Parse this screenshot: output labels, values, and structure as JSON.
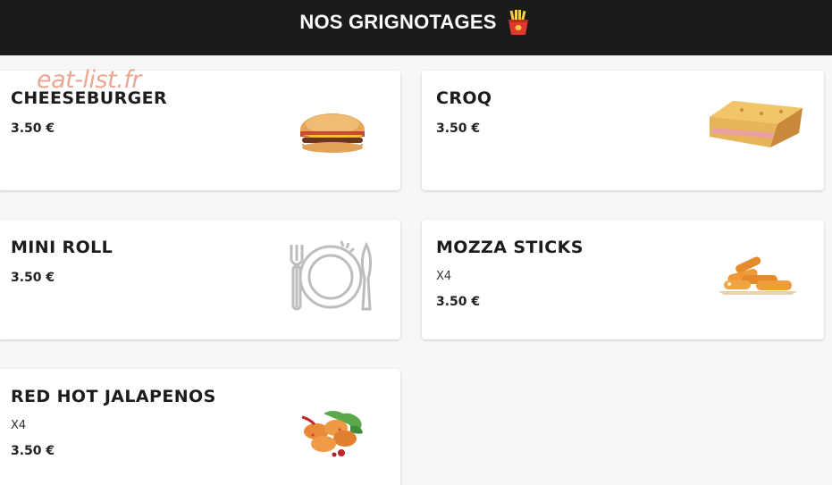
{
  "header": {
    "title": "NOS GRIGNOTAGES"
  },
  "watermark": "eat-list.fr",
  "items": [
    {
      "name": "CHEESEBURGER",
      "description": "",
      "price": "3.50 €",
      "image_icon": "cheeseburger-image"
    },
    {
      "name": "CROQ",
      "description": "",
      "price": "3.50 €",
      "image_icon": "croque-sandwich-image"
    },
    {
      "name": "MINI ROLL",
      "description": "",
      "price": "3.50 €",
      "image_icon": "plate-cutlery-placeholder-icon"
    },
    {
      "name": "MOZZA STICKS",
      "description": "X4",
      "price": "3.50 €",
      "image_icon": "mozza-sticks-image"
    },
    {
      "name": "RED HOT JALAPENOS",
      "description": "X4",
      "price": "3.50 €",
      "image_icon": "jalapenos-image"
    }
  ],
  "colors": {
    "header_bg": "#1b1b1b",
    "card_bg": "#ffffff",
    "page_bg": "#f7f7f7",
    "watermark": "#e8876e"
  }
}
